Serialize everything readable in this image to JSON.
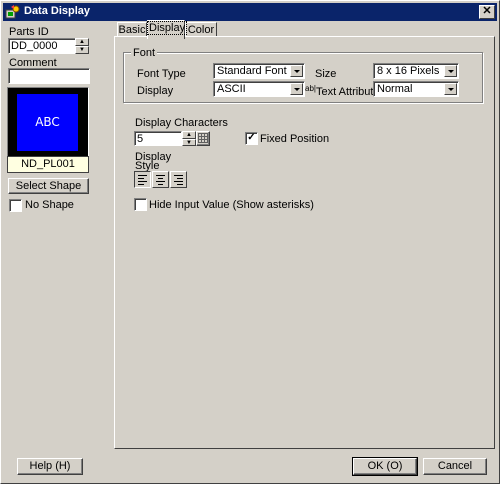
{
  "window": {
    "title": "Data Display",
    "close_glyph": "✕"
  },
  "left": {
    "parts_id_label": "Parts ID",
    "parts_id_value": "DD_0000",
    "comment_label": "Comment",
    "comment_value": "",
    "preview_text": "ABC",
    "shape_name": "ND_PL001",
    "select_shape_label": "Select Shape",
    "no_shape_label": "No Shape",
    "no_shape_checked": false
  },
  "tabs": [
    {
      "label": "Basic"
    },
    {
      "label": "Display",
      "active": true
    },
    {
      "label": "Color"
    }
  ],
  "font_group": {
    "title": "Font",
    "font_type_label": "Font Type",
    "font_type_value": "Standard Font",
    "size_label": "Size",
    "size_value": "8 x 16 Pixels",
    "display_label": "Display",
    "display_value": "ASCII",
    "text_attribute_label": "Text Attribute",
    "text_attribute_value": "Normal",
    "text_attribute_icon": "text-attribute-icon"
  },
  "display_chars": {
    "label": "Display Characters",
    "value": "5",
    "keypad_icon": "keypad-icon"
  },
  "fixed_position": {
    "label": "Fixed Position",
    "checked": true,
    "glyph": "✓"
  },
  "display_style": {
    "label": "Display Style",
    "buttons": [
      {
        "icon": "align-left-icon"
      },
      {
        "icon": "align-center-icon"
      },
      {
        "icon": "align-right-icon"
      }
    ]
  },
  "hide_input": {
    "label": "Hide Input Value (Show asterisks)",
    "checked": false
  },
  "footer": {
    "help_label": "Help (H)",
    "ok_label": "OK (O)",
    "cancel_label": "Cancel"
  }
}
